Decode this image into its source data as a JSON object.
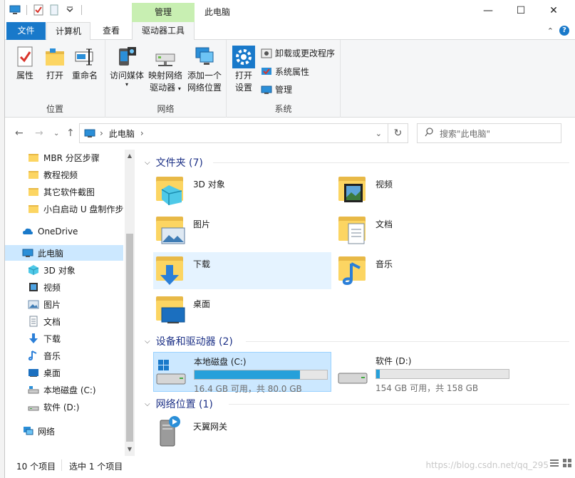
{
  "window": {
    "title": "此电脑"
  },
  "ribbon_tabs": {
    "file": "文件",
    "computer": "计算机",
    "view": "查看",
    "drive_tools": "驱动器工具",
    "context_header": "管理"
  },
  "ribbon": {
    "groups": {
      "location": "位置",
      "network": "网络",
      "system": "系统"
    },
    "properties": "属性",
    "open": "打开",
    "rename": "重命名",
    "access_media": "访问媒体",
    "map_drive_line1": "映射网络",
    "map_drive_line2": "驱动器",
    "add_location_line1": "添加一个",
    "add_location_line2": "网络位置",
    "open_settings_line1": "打开",
    "open_settings_line2": "设置",
    "uninstall": "卸载或更改程序",
    "system_properties": "系统属性",
    "manage": "管理"
  },
  "address": {
    "path": "此电脑",
    "search_placeholder": "搜索\"此电脑\""
  },
  "nav_pane": {
    "folders": [
      "MBR 分区步骤",
      "教程视频",
      "其它软件截图",
      "小白启动 U 盘制作步"
    ],
    "onedrive": "OneDrive",
    "this_pc": "此电脑",
    "pc_items": [
      "3D 对象",
      "视频",
      "图片",
      "文档",
      "下载",
      "音乐",
      "桌面",
      "本地磁盘 (C:)",
      "软件 (D:)"
    ],
    "network": "网络"
  },
  "content": {
    "folders_header": "文件夹 (7)",
    "folders": [
      "3D 对象",
      "视频",
      "图片",
      "文档",
      "下载",
      "音乐",
      "桌面"
    ],
    "devices_header": "设备和驱动器 (2)",
    "drives": [
      {
        "name": "本地磁盘 (C:)",
        "size": "16.4 GB 可用，共 80.0 GB",
        "used_fraction": 0.795
      },
      {
        "name": "软件 (D:)",
        "size": "154 GB 可用，共 158 GB",
        "used_fraction": 0.025
      }
    ],
    "network_header": "网络位置 (1)",
    "network_items": [
      "天翼网关"
    ]
  },
  "status": {
    "count": "10 个项目",
    "selected": "选中 1 个项目",
    "watermark": "https://blog.csdn.net/qq_295"
  },
  "colors": {
    "accent": "#1979ca",
    "selection": "#cce8ff",
    "ctx_tab": "#c8efb2",
    "drive_bar": "#26a0da",
    "header_text": "#1e3287"
  }
}
